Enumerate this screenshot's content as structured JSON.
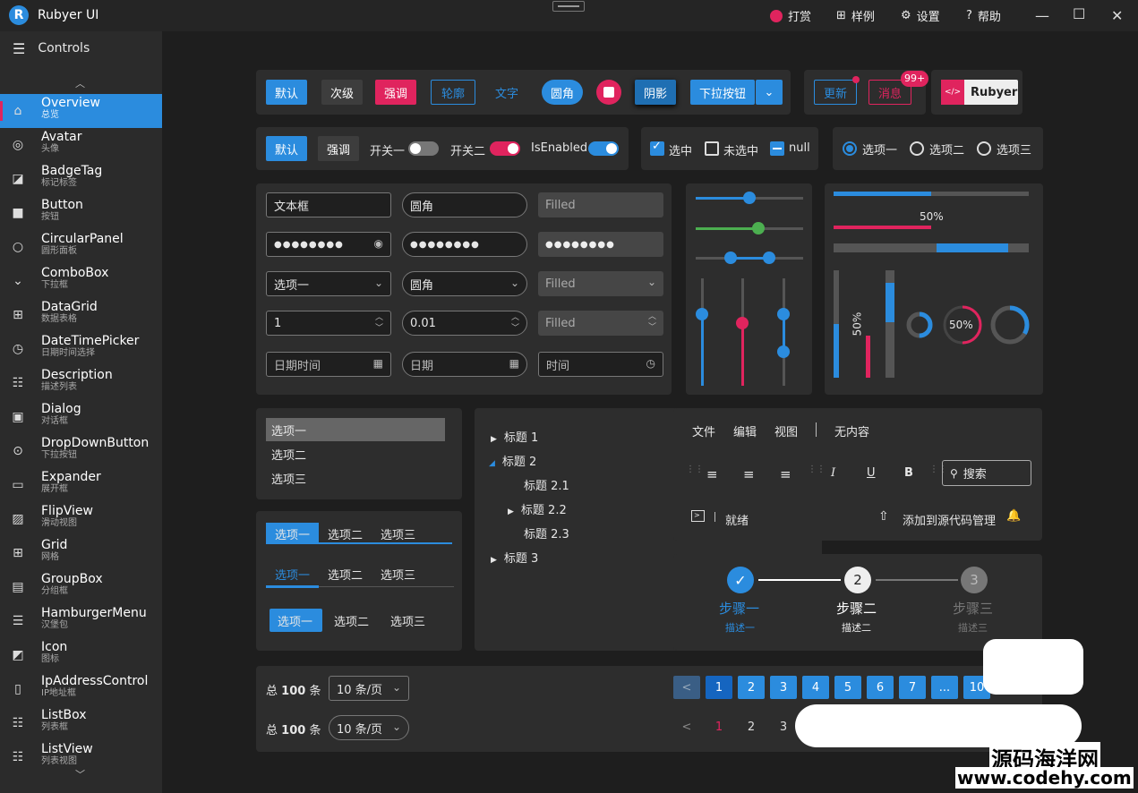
{
  "app": {
    "title": "Rubyer UI",
    "reward": "打赏",
    "samples": "样例",
    "settings": "设置",
    "help": "帮助"
  },
  "sidebar": {
    "header": "Controls",
    "items": [
      {
        "title": "Overview",
        "sub": "总览",
        "icon": "home-icon"
      },
      {
        "title": "Avatar",
        "sub": "头像",
        "icon": "avatar-icon"
      },
      {
        "title": "BadgeTag",
        "sub": "标记标签",
        "icon": "badge-icon"
      },
      {
        "title": "Button",
        "sub": "按钮",
        "icon": "button-icon"
      },
      {
        "title": "CircularPanel",
        "sub": "圆形面板",
        "icon": "circle-icon"
      },
      {
        "title": "ComboBox",
        "sub": "下拉框",
        "icon": "chevron-down-icon"
      },
      {
        "title": "DataGrid",
        "sub": "数据表格",
        "icon": "grid-icon"
      },
      {
        "title": "DateTimePicker",
        "sub": "日期时间选择",
        "icon": "clock-icon"
      },
      {
        "title": "Description",
        "sub": "描述列表",
        "icon": "list-icon"
      },
      {
        "title": "Dialog",
        "sub": "对话框",
        "icon": "dialog-icon"
      },
      {
        "title": "DropDownButton",
        "sub": "下拉按钮",
        "icon": "dropdown-icon"
      },
      {
        "title": "Expander",
        "sub": "展开框",
        "icon": "expander-icon"
      },
      {
        "title": "FlipView",
        "sub": "滑动视图",
        "icon": "image-icon"
      },
      {
        "title": "Grid",
        "sub": "网格",
        "icon": "grid-icon"
      },
      {
        "title": "GroupBox",
        "sub": "分组框",
        "icon": "groupbox-icon"
      },
      {
        "title": "HamburgerMenu",
        "sub": "汉堡包",
        "icon": "hamburger-icon"
      },
      {
        "title": "Icon",
        "sub": "图标",
        "icon": "icon-icon"
      },
      {
        "title": "IpAddressControl",
        "sub": "IP地址框",
        "icon": "ip-icon"
      },
      {
        "title": "ListBox",
        "sub": "列表框",
        "icon": "list-icon"
      },
      {
        "title": "ListView",
        "sub": "列表视图",
        "icon": "list-icon"
      }
    ]
  },
  "buttons": {
    "default": "默认",
    "secondary": "次级",
    "emphasis": "强调",
    "outline": "轮廓",
    "text": "文字",
    "round": "圆角",
    "shadow": "阴影",
    "dropdown": "下拉按钮",
    "update": "更新",
    "message": "消息",
    "badge_count": "99+",
    "brand": "Rubyer"
  },
  "toggles": {
    "default": "默认",
    "emphasis": "强调",
    "switch1": "开关一",
    "switch2": "开关二",
    "isEnabled": "IsEnabled"
  },
  "checks": {
    "checked": "选中",
    "unchecked": "未选中",
    "null": "null"
  },
  "radios": {
    "r1": "选项一",
    "r2": "选项二",
    "r3": "选项三"
  },
  "inputs": {
    "text": "文本框",
    "round": "圆角",
    "filled": "Filled",
    "password": "●●●●●●●●",
    "combo1": "选项一",
    "combo2": "圆角",
    "combo3": "Filled",
    "num1": "1",
    "num2": "0.01",
    "num3": "Filled",
    "datetime": "日期时间",
    "date": "日期",
    "time": "时间"
  },
  "progress": {
    "label1": "50%",
    "label2": "50%",
    "label3": "50%",
    "value": 0.5
  },
  "listbox": {
    "items": [
      "选项一",
      "选项二",
      "选项三"
    ]
  },
  "tabs": {
    "items": [
      "选项一",
      "选项二",
      "选项三"
    ]
  },
  "tree": {
    "items": [
      "标题 1",
      "标题 2",
      "标题 2.1",
      "标题 2.2",
      "标题 2.3",
      "标题 3"
    ]
  },
  "toolbar": {
    "file": "文件",
    "edit": "编辑",
    "view": "视图",
    "none": "无内容",
    "search": "搜索",
    "ready": "就绪",
    "source": "添加到源代码管理"
  },
  "steps": {
    "s1": "步骤一",
    "d1": "描述一",
    "s2": "步骤二",
    "d2": "描述二",
    "s3": "步骤三",
    "d3": "描述三",
    "n2": "2",
    "n3": "3"
  },
  "pagination": {
    "total_prefix": "总",
    "total": "100",
    "total_suffix": "条",
    "per_page": "10 条/页",
    "pages": [
      "1",
      "2",
      "3",
      "4",
      "5",
      "6",
      "7",
      "...",
      "10"
    ],
    "prev": "<"
  },
  "watermark": {
    "site": "源码海洋网",
    "url": "www.codehy.com"
  }
}
